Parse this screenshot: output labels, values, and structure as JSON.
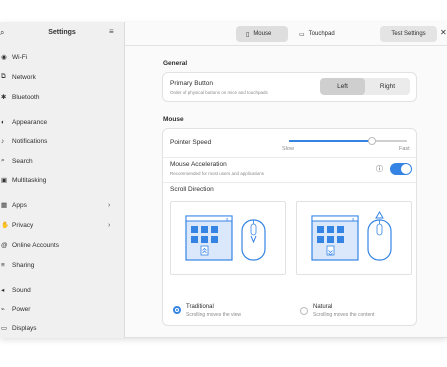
{
  "sidebar": {
    "title": "Settings",
    "search_icon": "search-icon",
    "menu_icon": "hamburger-menu-icon",
    "items": [
      {
        "label": "Wi-Fi",
        "icon": "wifi-icon",
        "glyph": "◉"
      },
      {
        "label": "Network",
        "icon": "network-icon",
        "glyph": "⧉"
      },
      {
        "label": "Bluetooth",
        "icon": "bluetooth-icon",
        "glyph": "✱"
      },
      {
        "label": "Appearance",
        "icon": "appearance-icon",
        "glyph": "◐"
      },
      {
        "label": "Notifications",
        "icon": "bell-icon",
        "glyph": "♪"
      },
      {
        "label": "Search",
        "icon": "search-icon",
        "glyph": "⌕"
      },
      {
        "label": "Multitasking",
        "icon": "multitasking-icon",
        "glyph": "▣"
      },
      {
        "label": "Apps",
        "icon": "apps-icon",
        "glyph": "▦"
      },
      {
        "label": "Privacy",
        "icon": "hand-icon",
        "glyph": "✋"
      },
      {
        "label": "Online Accounts",
        "icon": "at-icon",
        "glyph": "@"
      },
      {
        "label": "Sharing",
        "icon": "share-icon",
        "glyph": "≡"
      },
      {
        "label": "Sound",
        "icon": "speaker-icon",
        "glyph": "◂"
      },
      {
        "label": "Power",
        "icon": "power-icon",
        "glyph": "⌁"
      },
      {
        "label": "Displays",
        "icon": "display-icon",
        "glyph": "▭"
      }
    ]
  },
  "header": {
    "tabs": [
      {
        "label": "Mouse",
        "icon": "mouse-icon",
        "active": true
      },
      {
        "label": "Touchpad",
        "icon": "touchpad-icon",
        "active": false
      }
    ],
    "test_button": "Test Settings",
    "close_icon": "close-icon"
  },
  "general": {
    "section_title": "General",
    "primary_button": {
      "title": "Primary Button",
      "subtitle": "Order of physical buttons on mice and touchpads",
      "options": [
        "Left",
        "Right"
      ],
      "selected": "Left"
    }
  },
  "mouse": {
    "section_title": "Mouse",
    "pointer_speed": {
      "title": "Pointer Speed",
      "min_label": "Slow",
      "max_label": "Fast",
      "value_fraction": 0.7
    },
    "acceleration": {
      "title": "Mouse Acceleration",
      "subtitle": "Recommended for most users and applications",
      "enabled": true
    },
    "scroll_direction": {
      "title": "Scroll Direction",
      "options": [
        {
          "title": "Traditional",
          "subtitle": "Scrolling moves the view",
          "selected": true
        },
        {
          "title": "Natural",
          "subtitle": "Scrolling moves the content",
          "selected": false
        }
      ]
    }
  },
  "colors": {
    "accent": "#3584e4",
    "sidebar_bg": "#f0f0f0",
    "content_bg": "#fafafa"
  }
}
